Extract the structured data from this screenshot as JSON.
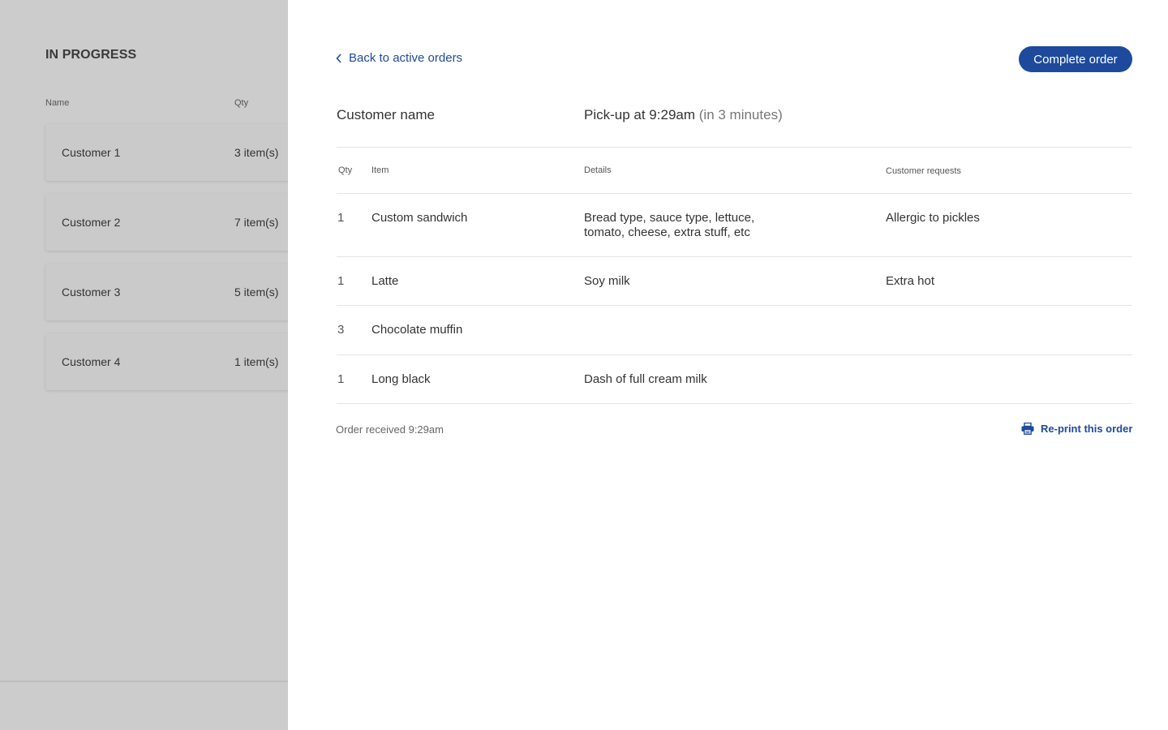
{
  "left_panel": {
    "title": "IN PROGRESS",
    "columns": {
      "name": "Name",
      "qty": "Qty"
    },
    "orders": [
      {
        "name": "Customer 1",
        "qty": "3 item(s)"
      },
      {
        "name": "Customer 2",
        "qty": "7 item(s)"
      },
      {
        "name": "Customer 3",
        "qty": "5 item(s)"
      },
      {
        "name": "Customer 4",
        "qty": "1 item(s)"
      }
    ]
  },
  "detail": {
    "back_label": "Back to active orders",
    "complete_label": "Complete order",
    "customer_name": "Customer name",
    "pickup_time": "Pick-up at 9:29am",
    "pickup_relative": "(in 3 minutes)",
    "columns": {
      "qty": "Qty",
      "item": "Item",
      "details": "Details",
      "requests": "Customer requests"
    },
    "items": [
      {
        "qty": "1",
        "item": "Custom sandwich",
        "details": "Bread type, sauce type, lettuce, tomato, cheese, extra stuff, etc",
        "requests": "Allergic to pickles"
      },
      {
        "qty": "1",
        "item": "Latte",
        "details": "Soy milk",
        "requests": "Extra hot"
      },
      {
        "qty": "3",
        "item": "Chocolate muffin",
        "details": "",
        "requests": ""
      },
      {
        "qty": "1",
        "item": "Long black",
        "details": "Dash of full cream milk",
        "requests": ""
      }
    ],
    "received": "Order received 9:29am",
    "reprint_label": "Re-print this order"
  },
  "icons": {
    "back": "chevron-left-icon",
    "reprint": "printer-icon"
  },
  "colors": {
    "accent": "#1d4a9c",
    "overlay": "#cccccc"
  }
}
